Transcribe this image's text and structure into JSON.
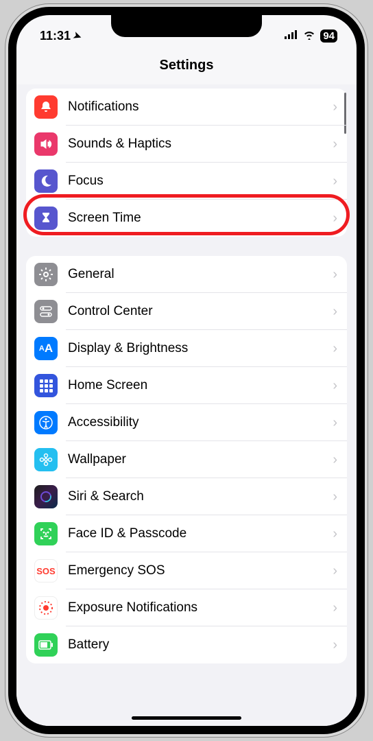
{
  "status": {
    "time": "11:31",
    "battery": "94"
  },
  "header": {
    "title": "Settings"
  },
  "group1": {
    "notifications": "Notifications",
    "sounds": "Sounds & Haptics",
    "focus": "Focus",
    "screentime": "Screen Time"
  },
  "group2": {
    "general": "General",
    "control": "Control Center",
    "display": "Display & Brightness",
    "home": "Home Screen",
    "accessibility": "Accessibility",
    "wallpaper": "Wallpaper",
    "siri": "Siri & Search",
    "faceid": "Face ID & Passcode",
    "sos": "Emergency SOS",
    "exposure": "Exposure Notifications",
    "battery": "Battery"
  },
  "sos_text": "SOS",
  "colors": {
    "notifications": "#ff3b30",
    "sounds": "#ea386b",
    "focus": "#5756ce",
    "screentime": "#5756ce",
    "general": "#8e8e93",
    "control": "#8e8e93",
    "display": "#007aff",
    "home": "#3355dd",
    "accessibility": "#007aff",
    "wallpaper": "#24bff0",
    "faceid": "#30d158",
    "sos_bg": "#ffffff",
    "sos_fg": "#ff3b30",
    "exposure": "#ffffff",
    "exposure_fg": "#ff3b30",
    "battery": "#30d158"
  },
  "annotation": {
    "highlighted_item": "screen-time"
  }
}
